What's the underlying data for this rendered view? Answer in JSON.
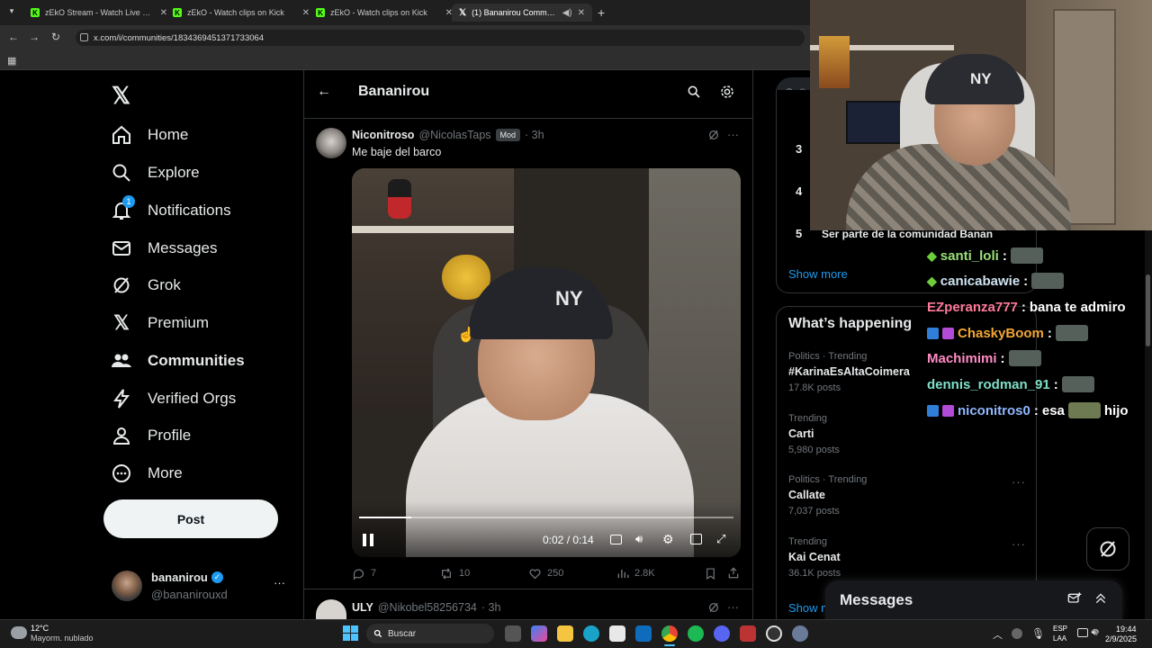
{
  "browser": {
    "tabs": [
      {
        "title": "zEkO Stream - Watch Live on Kick",
        "icon": "kick-icon"
      },
      {
        "title": "zEkO - Watch clips on Kick",
        "icon": "kick-icon"
      },
      {
        "title": "zEkO - Watch clips on Kick",
        "icon": "kick-icon"
      },
      {
        "title": "(1) Bananirou Community / X",
        "icon": "x-icon"
      }
    ],
    "url": "x.com/i/communities/1834369451371733064"
  },
  "nav": {
    "items": [
      {
        "label": "Home",
        "icon": "home-icon"
      },
      {
        "label": "Explore",
        "icon": "search-icon"
      },
      {
        "label": "Notifications",
        "icon": "bell-icon",
        "badge": "1"
      },
      {
        "label": "Messages",
        "icon": "mail-icon"
      },
      {
        "label": "Grok",
        "icon": "grok-icon"
      },
      {
        "label": "Premium",
        "icon": "x-icon"
      },
      {
        "label": "Communities",
        "icon": "people-icon"
      },
      {
        "label": "Verified Orgs",
        "icon": "lightning-icon"
      },
      {
        "label": "Profile",
        "icon": "person-icon"
      },
      {
        "label": "More",
        "icon": "more-circle-icon"
      }
    ],
    "post_label": "Post",
    "account": {
      "name": "bananirou",
      "handle": "@bananirouxd"
    }
  },
  "header": {
    "title": "Bananirou"
  },
  "tweet1": {
    "name": "Niconitroso",
    "handle": "@NicolasTaps",
    "badge": "Mod",
    "time": "· 3h",
    "text": "Me baje del barco",
    "video_time": "0:02 / 0:14",
    "video_progress": 0.14,
    "replies": "7",
    "reposts": "10",
    "likes": "250",
    "views": "2.8K"
  },
  "tweet2": {
    "name": "ULY",
    "handle": "@Nikobel58256734",
    "time": "· 3h"
  },
  "right": {
    "search_label": "Se",
    "list_numbers": [
      "3",
      "4",
      "5"
    ],
    "list_item5_text": "Ser parte de la comunidad Banan",
    "show_more": "Show more",
    "whats_happening": "What’s happening",
    "trends": [
      {
        "meta": "Politics · Trending",
        "name": "#KarinaEsAltaCoimera",
        "posts": "17.8K posts"
      },
      {
        "meta": "Trending",
        "name": "Carti",
        "posts": "5,980 posts"
      },
      {
        "meta": "Politics · Trending",
        "name": "Callate",
        "posts": "7,037 posts"
      },
      {
        "meta": "Trending",
        "name": "Kai Cenat",
        "posts": "36.1K posts"
      }
    ],
    "show_more2": "Show m"
  },
  "chat": [
    {
      "user": "santi_loli",
      "color": "#9be07a",
      "msg": "",
      "badge": "diamond"
    },
    {
      "user": "canicabawie",
      "color": "#cfe3f0",
      "msg": "",
      "badge": "diamond"
    },
    {
      "user": "EZperanza777",
      "color": "#ff7a9a",
      "msg": "bana te admiro",
      "badge": ""
    },
    {
      "user": "ChaskyBoom",
      "color": "#f2a634",
      "msg": "",
      "badge": "sub"
    },
    {
      "user": "Machimimi",
      "color": "#ff8bc4",
      "msg": "",
      "badge": ""
    },
    {
      "user": "dennis_rodman_91",
      "color": "#7fe0c8",
      "msg": "",
      "badge": ""
    },
    {
      "user": "niconitros0",
      "color": "#8fb8ff",
      "msg": "esa",
      "msg2": "hijo",
      "badge": "sub"
    }
  ],
  "messages_dock": {
    "title": "Messages"
  },
  "taskbar": {
    "weather_temp": "12°C",
    "weather_desc": "Mayorm. nublado",
    "search": "Buscar",
    "lang1": "ESP",
    "lang2": "LAA",
    "time": "19:44",
    "date": "2/9/2025"
  },
  "colors": {
    "accent": "#1d9bf0",
    "kick": "#53fc18",
    "verified": "#1d9bf0"
  }
}
